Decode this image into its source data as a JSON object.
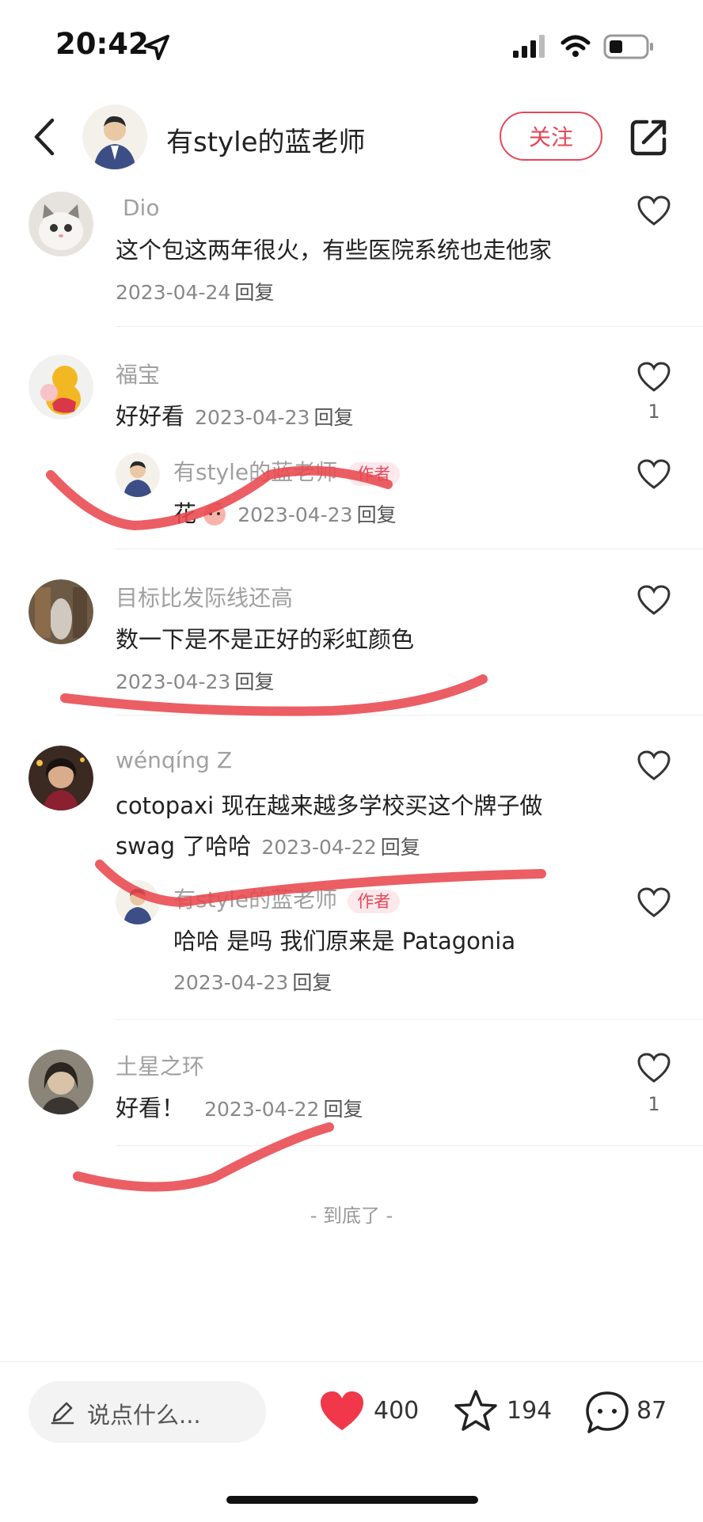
{
  "status_bar": {
    "time": "20:42"
  },
  "header": {
    "title": "有style的蓝老师",
    "follow_label": "关注"
  },
  "comments": [
    {
      "name": "Dio",
      "text": "这个包这两年很火，有些医院系统也走他家",
      "date": "2023-04-24",
      "reply": "回复",
      "likes": ""
    },
    {
      "name": "福宝",
      "text": "好好看",
      "date": "2023-04-23",
      "reply": "回复",
      "likes": "1",
      "reply_item": {
        "name": "有style的蓝老师",
        "badge": "作者",
        "text": "花",
        "date": "2023-04-23",
        "reply": "回复"
      }
    },
    {
      "name": "目标比发际线还高",
      "text": "数一下是不是正好的彩虹颜色",
      "date": "2023-04-23",
      "reply": "回复",
      "likes": ""
    },
    {
      "name": "wénqíng Z",
      "text_line1": "cotopaxi 现在越来越多学校买这个牌子做",
      "text_line2": "swag 了哈哈",
      "date": "2023-04-22",
      "reply": "回复",
      "likes": "",
      "reply_item": {
        "name": "有style的蓝老师",
        "badge": "作者",
        "text": "哈哈 是吗 我们原来是 Patagonia",
        "date": "2023-04-23",
        "reply": "回复"
      }
    },
    {
      "name": "土星之环",
      "text": "好看！",
      "date": "2023-04-22",
      "reply": "回复",
      "likes": "1"
    }
  ],
  "end_text": "- 到底了 -",
  "bottom_bar": {
    "input_placeholder": "说点什么...",
    "likes": "400",
    "stars": "194",
    "comments": "87"
  },
  "colors": {
    "accent": "#e64758",
    "heart_filled": "#f0384a",
    "annotation": "#e8484e"
  }
}
